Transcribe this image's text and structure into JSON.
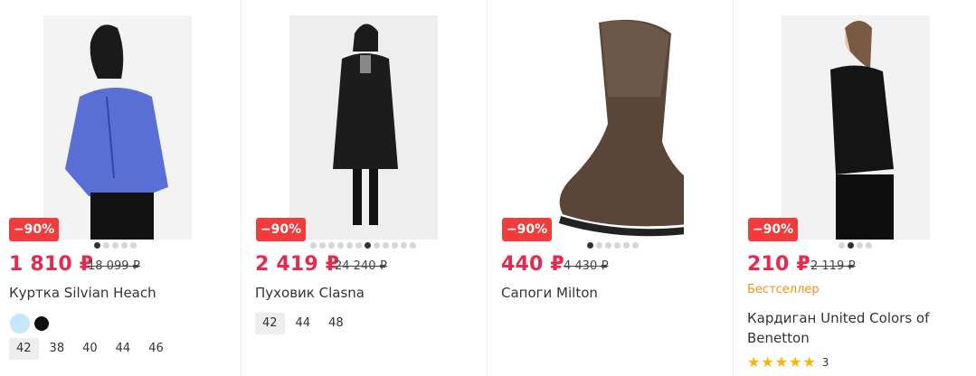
{
  "products": [
    {
      "discount": "−90%",
      "price": "1 810 ₽",
      "old_price": "18 099 ₽",
      "title": "Куртка Silvian Heach",
      "image_alt": "woman in blue leather jacket",
      "colors": [
        "#c6e6f9",
        "#111111"
      ],
      "sizes": [
        "42",
        "38",
        "40",
        "44",
        "46"
      ],
      "selected_size": "42",
      "gallery": {
        "count": 5,
        "active": 1
      }
    },
    {
      "discount": "−90%",
      "price": "2 419 ₽",
      "old_price": "24 240 ₽",
      "title": "Пуховик Clasna",
      "image_alt": "woman in long black down coat",
      "sizes": [
        "42",
        "44",
        "48"
      ],
      "selected_size": "42",
      "gallery": {
        "count": 12,
        "active": 7
      }
    },
    {
      "discount": "−90%",
      "price": "440 ₽",
      "old_price": "4 430 ₽",
      "title": "Сапоги Milton",
      "image_alt": "brown studded winter boot",
      "gallery": {
        "count": 6,
        "active": 1
      }
    },
    {
      "discount": "−90%",
      "price": "210 ₽",
      "old_price": "2 119 ₽",
      "badge_label": "Бестселлер",
      "title_line1": "Кардиган United Colors of",
      "title_line2": "Benetton",
      "rating": 4.5,
      "rating_count": "3",
      "image_alt": "woman in black cardigan",
      "gallery": {
        "count": 4,
        "active": 2
      }
    }
  ],
  "colors": {
    "accent_price": "#e6294f",
    "badge_bg": "#f23b3b",
    "bestseller": "#f0901e",
    "star": "#f5b50a"
  }
}
